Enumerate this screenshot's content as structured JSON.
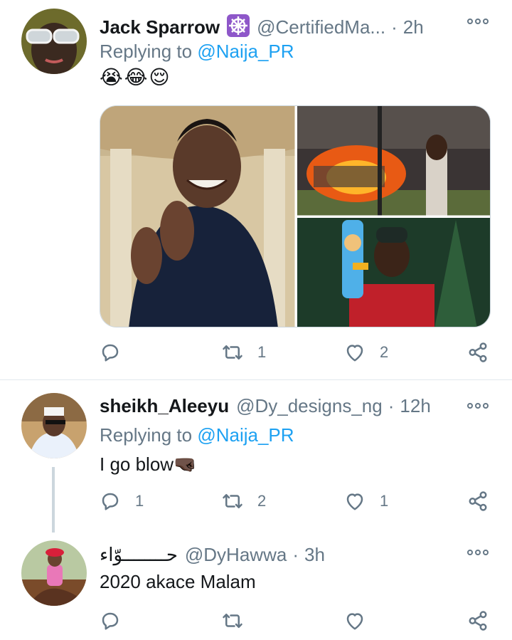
{
  "tweets": [
    {
      "name": "Jack Sparrow",
      "handle": "@CertifiedMa...",
      "time": "2h",
      "replying_prefix": "Replying to ",
      "replying_to": "@Naija_PR",
      "text": "😭😂😌",
      "actions": {
        "reply": "",
        "retweet": "1",
        "like": "2"
      }
    },
    {
      "name": "sheikh_Aleeyu",
      "handle": "@Dy_designs_ng",
      "time": "12h",
      "replying_prefix": "Replying to ",
      "replying_to": "@Naija_PR",
      "text": "I go blow🤜🏿",
      "actions": {
        "reply": "1",
        "retweet": "2",
        "like": "1"
      }
    },
    {
      "name": "حــــــــوّاء",
      "handle": "@DyHawwa",
      "time": "3h",
      "text": "2020 akace Malam",
      "actions": {
        "reply": "",
        "retweet": "",
        "like": ""
      }
    }
  ],
  "colors": {
    "link": "#1da1f2",
    "muted": "#657786",
    "text": "#14171a",
    "divider": "#e1e8ed"
  },
  "icons": [
    "reply-icon",
    "retweet-icon",
    "like-icon",
    "share-icon",
    "more-options-icon",
    "verified-badge-icon"
  ]
}
